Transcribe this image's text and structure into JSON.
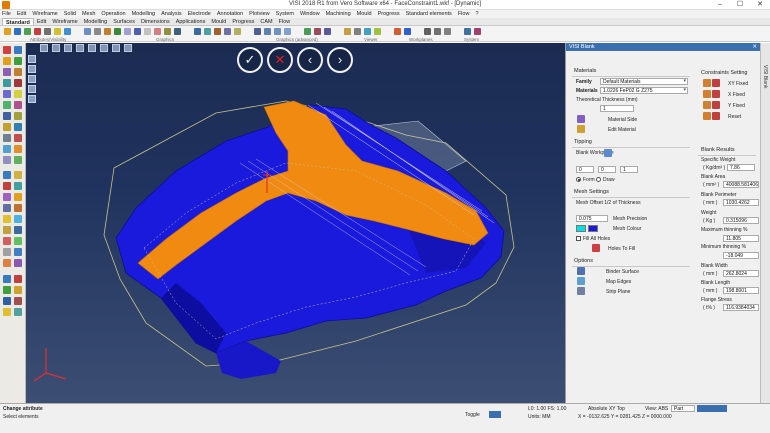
{
  "window": {
    "title": "VISI 2018 R1 from Vero Software x64 - FaceConstraint1.wkf - [Dynamic]",
    "controls": [
      "–",
      "☐",
      "✕"
    ]
  },
  "menu": [
    "File",
    "Edit",
    "Wireframe",
    "Solid",
    "Mesh",
    "Operation",
    "Modelling",
    "Analysis",
    "Electrode",
    "Annotation",
    "Plotview",
    "System",
    "Window",
    "Machining",
    "Mould",
    "Progress",
    "Standard elements",
    "Flow",
    "?"
  ],
  "tabs": [
    "Standard",
    "Edit",
    "Wireframe",
    "Modelling",
    "Surfaces",
    "Dimensions",
    "Applications",
    "Mould",
    "Progress",
    "CAM",
    "Flow"
  ],
  "toolbar_groups": [
    "Attributes/Visibility",
    "Graphics",
    "Graphics (advanced)",
    "Viewer",
    "Workplanes",
    "System"
  ],
  "viewport_controls": {
    "ok": "✓",
    "cancel": "✕",
    "prev": "‹",
    "next": "›"
  },
  "panel": {
    "title": "VISI Blank",
    "close": "✕",
    "materials": {
      "title": "Materials",
      "family_label": "Family",
      "family_value": "Default Materials",
      "materials_label": "Materials",
      "materials_value": "1.0226 FeP02 G Z275",
      "thickness_label": "Theoretical Thickness (mm)",
      "thickness_value": "1",
      "material_side": "Material Side",
      "edit_material": "Edit Material"
    },
    "typing": {
      "title": "Tipping",
      "workplane_label": "Blank Workplane",
      "x": "0",
      "y": "0",
      "z": "1",
      "form": "Form",
      "draw": "Draw"
    },
    "mesh": {
      "title": "Mesh Settings",
      "offset_label": "Mesh Offset 1/2 of Thickness",
      "precision_value": "0.075",
      "precision_label": "Mesh Precision",
      "colour_label": "Mesh Colour",
      "fill_all_holes": "Fill All Holes",
      "holes_to_fill": "Holes To Fill"
    },
    "options": {
      "title": "Options",
      "binder_surface": "Binder Surface",
      "map_edges": "Map Edges",
      "strip_plane": "Strip Plane"
    },
    "constraints": {
      "title": "Constraints Setting",
      "xy_fixed": "XY Fixed",
      "x_fixed": "X Fixed",
      "y_fixed": "Y Fixed",
      "reset": "Reset"
    },
    "results": {
      "title": "Blank Results",
      "specific_weight_label": "Specific Weight",
      "specific_weight_unit": "( Kg/dm³ )",
      "specific_weight_value": "7.86",
      "blank_area_label": "Blank Area",
      "blank_area_unit": "( mm² )",
      "blank_area_value": "40088.5814061",
      "perimeter_label": "Blank Perimeter",
      "perimeter_unit": "( mm )",
      "perimeter_value": "1030.4262",
      "weight_label": "Weight",
      "weight_unit": "( Kg )",
      "weight_value": "0.315096",
      "max_thin_label": "Maximum thinning %",
      "max_thin_value": "11.805",
      "min_thin_label": "Minimum thinning %",
      "min_thin_value": "-18.049",
      "width_label": "Blank Width",
      "width_unit": "( mm )",
      "width_value": "262.8024",
      "length_label": "Blank Length",
      "length_unit": "( mm )",
      "length_value": "198.8001",
      "stress_label": "Flange Stress",
      "stress_unit": "( t% )",
      "stress_value": "116.9384034"
    }
  },
  "right_strip": "VISI Blank",
  "status": {
    "line1": "Change attribute",
    "line2": "Select elements",
    "toggle": "Toggle",
    "level": "L0: 1.00 FS: 1.00",
    "units": "Units: MM",
    "coords": "X = -0132.625 Y = 0281.425 Z = 0000.000",
    "abs": "Absolute XY Top",
    "view": "View: ABS",
    "part": "Part"
  },
  "colors": {
    "part_blue": "#1a1adc",
    "part_orange": "#f08a10",
    "viewport_bg": "#1f3058",
    "mesh_colour": "#00e0e0"
  }
}
